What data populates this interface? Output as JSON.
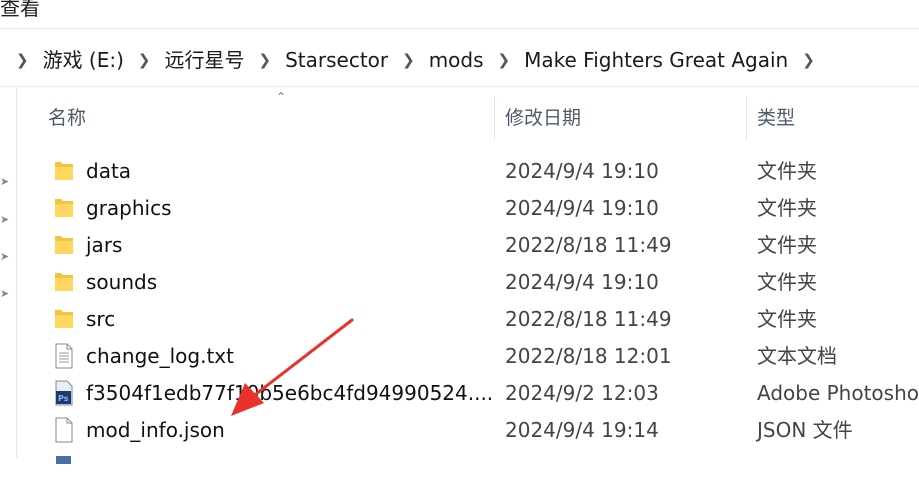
{
  "menu": {
    "view_label": "查看"
  },
  "breadcrumb": [
    "游戏 (E:)",
    "远行星号",
    "Starsector",
    "mods",
    "Make Fighters Great Again"
  ],
  "columns": {
    "name": "名称",
    "modified": "修改日期",
    "type": "类型"
  },
  "files": [
    {
      "name": "data",
      "modified": "2024/9/4 19:10",
      "type": "文件夹",
      "icon": "folder-icon"
    },
    {
      "name": "graphics",
      "modified": "2024/9/4 19:10",
      "type": "文件夹",
      "icon": "folder-icon"
    },
    {
      "name": "jars",
      "modified": "2022/8/18 11:49",
      "type": "文件夹",
      "icon": "folder-icon"
    },
    {
      "name": "sounds",
      "modified": "2024/9/4 19:10",
      "type": "文件夹",
      "icon": "folder-icon"
    },
    {
      "name": "src",
      "modified": "2022/8/18 11:49",
      "type": "文件夹",
      "icon": "folder-icon"
    },
    {
      "name": "change_log.txt",
      "modified": "2022/8/18 12:01",
      "type": "文本文档",
      "icon": "text-file-icon"
    },
    {
      "name": "f3504f1edb77f10b5e6bc4fd94990524....",
      "modified": "2024/9/2 12:03",
      "type": "Adobe Photosho",
      "icon": "photoshop-file-icon"
    },
    {
      "name": "mod_info.json",
      "modified": "2024/9/4 19:14",
      "type": "JSON 文件",
      "icon": "json-file-icon"
    }
  ],
  "colors": {
    "arrow": "#e8322b",
    "folder": "#f5c341",
    "header_text": "#4d5a6a"
  }
}
